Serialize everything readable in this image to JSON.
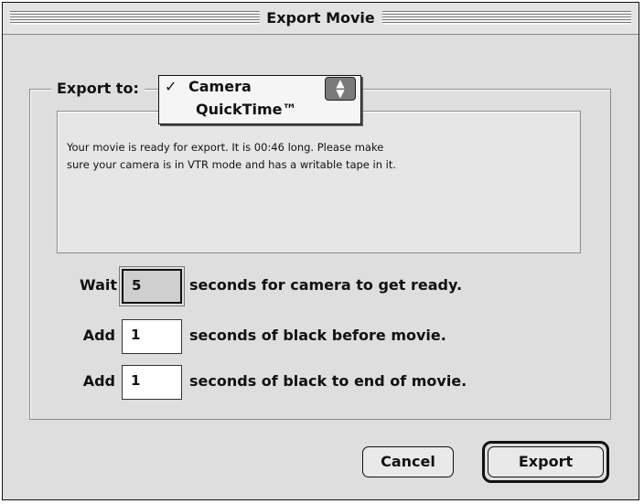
{
  "window": {
    "title": "Export Movie"
  },
  "export_to": {
    "label": "Export to:",
    "options": [
      {
        "check": "✓",
        "label": "Camera",
        "selected": true
      },
      {
        "check": "",
        "label": "QuickTime™",
        "selected": false
      }
    ],
    "arrow_icon": "up-down-arrows-icon"
  },
  "message": "Your movie is ready for export.  It is 00:46 long. Please make\nsure your camera is in VTR mode and has a writable tape in it.",
  "rows": [
    {
      "label": "Wait",
      "value": "5",
      "text": "seconds for camera to get ready."
    },
    {
      "label": "Add",
      "value": "1",
      "text": "seconds of black before movie."
    },
    {
      "label": "Add",
      "value": "1",
      "text": "seconds of black to end of movie."
    }
  ],
  "buttons": {
    "cancel": "Cancel",
    "export": "Export"
  }
}
